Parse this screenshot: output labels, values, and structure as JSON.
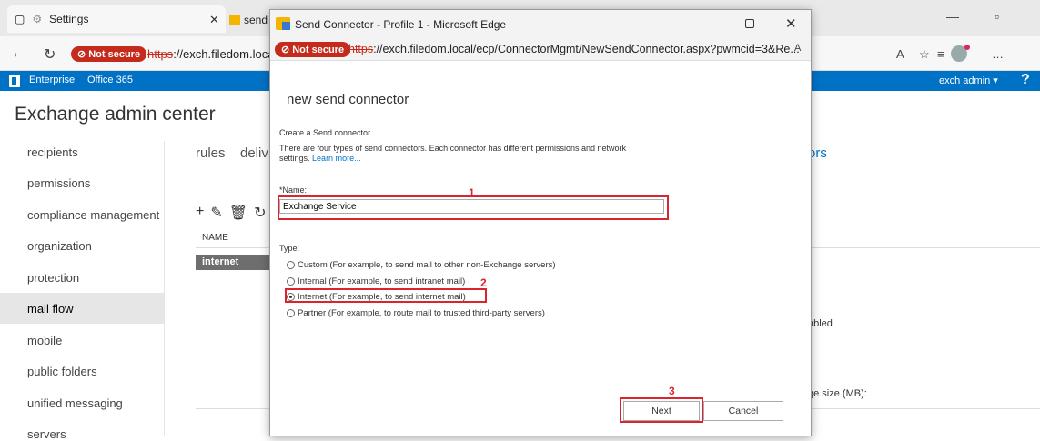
{
  "browser": {
    "tab_label": "Settings",
    "tab2_label": "send",
    "not_secure": "Not secure",
    "url_https": "https",
    "url_rest": "://exch.filedom.local/"
  },
  "o365": {
    "enterprise": "Enterprise",
    "office365": "Office 365",
    "user": "exch admin ▾",
    "help": "?"
  },
  "eac": {
    "title": "Exchange admin center",
    "nav": [
      "recipients",
      "permissions",
      "compliance management",
      "organization",
      "protection",
      "mail flow",
      "mobile",
      "public folders",
      "unified messaging",
      "servers"
    ],
    "active_nav": "mail flow",
    "subnav_rules": "rules",
    "subnav_deliv": "deliv",
    "subnav_ors": "ors",
    "col_name": "NAME",
    "row_internet": "internet",
    "partial_abled": "abled",
    "partial_size": "ge size (MB):"
  },
  "popup": {
    "title": "Send Connector - Profile 1 - Microsoft Edge",
    "not_secure": "Not secure",
    "url_https": "https",
    "url_rest": "://exch.filedom.local/ecp/ConnectorMgmt/NewSendConnector.aspx?pwmcid=3&Re..."
  },
  "dialog": {
    "heading": "new send connector",
    "create_text": "Create a Send connector.",
    "desc_text": "There are four types of send connectors. Each connector has different permissions and network settings.",
    "learn_more": "Learn more...",
    "name_label": "*Name:",
    "name_value": "Exchange Service",
    "type_label": "Type:",
    "types": [
      {
        "label": "Custom (For example, to send mail to other non-Exchange servers)",
        "selected": false
      },
      {
        "label": "Internal (For example, to send intranet mail)",
        "selected": false
      },
      {
        "label": "Internet (For example, to send internet mail)",
        "selected": true
      },
      {
        "label": "Partner (For example, to route mail to trusted third-party servers)",
        "selected": false
      }
    ],
    "next_label": "Next",
    "cancel_label": "Cancel"
  },
  "annotations": {
    "step1": "1",
    "step2": "2",
    "step3": "3",
    "color": "#d9262e"
  }
}
